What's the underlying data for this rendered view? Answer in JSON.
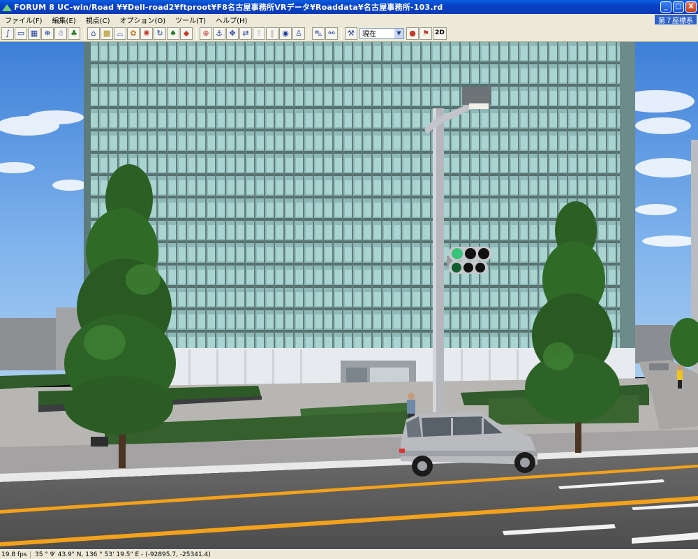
{
  "window": {
    "title": "FORUM 8    UC-win/Road    ¥¥Dell-road2¥ftproot¥F8名古屋事務所VRデータ¥Roaddata¥名古屋事務所-103.rd",
    "buttons": {
      "minimize": "_",
      "maximize": "□",
      "close": "X"
    }
  },
  "menu": {
    "items": [
      "ファイル(F)",
      "編集(E)",
      "視点(C)",
      "オプション(O)",
      "ツール(T)",
      "ヘルプ(H)"
    ],
    "coordinate_system": "第７座標系"
  },
  "toolbar": {
    "time_select": "現在",
    "mode_2d": "2D",
    "icons": [
      "road-icon",
      "vehicle-icon",
      "map-icon",
      "pedestrian-icon",
      "walk-icon",
      "tree-icon",
      "model-icon",
      "texture-icon",
      "bridge-icon",
      "scene-icon",
      "fire-icon",
      "recycle-icon",
      "tree-edit-icon",
      "car-model-icon",
      "target-icon",
      "anchor-icon",
      "move-icon",
      "drive-icon",
      "arrow-icon",
      "globe-icon",
      "person-icon",
      "pause-icon",
      "car-icon",
      "link-icon",
      "tool-icon",
      "traffic-light-icon",
      "flag-icon"
    ]
  },
  "colors": {
    "titlebar": "#0842c4",
    "menubar": "#ece9d8",
    "sky": "#4a8fe0",
    "road": "#5a5a5a",
    "center_line": "#f4a21b"
  },
  "statusbar": {
    "fps": "19.8 fps",
    "coords": "35 °   9' 43.9\" N, 136 °   53' 19.5\" E  -  (-92895.7, -25341.4)"
  }
}
